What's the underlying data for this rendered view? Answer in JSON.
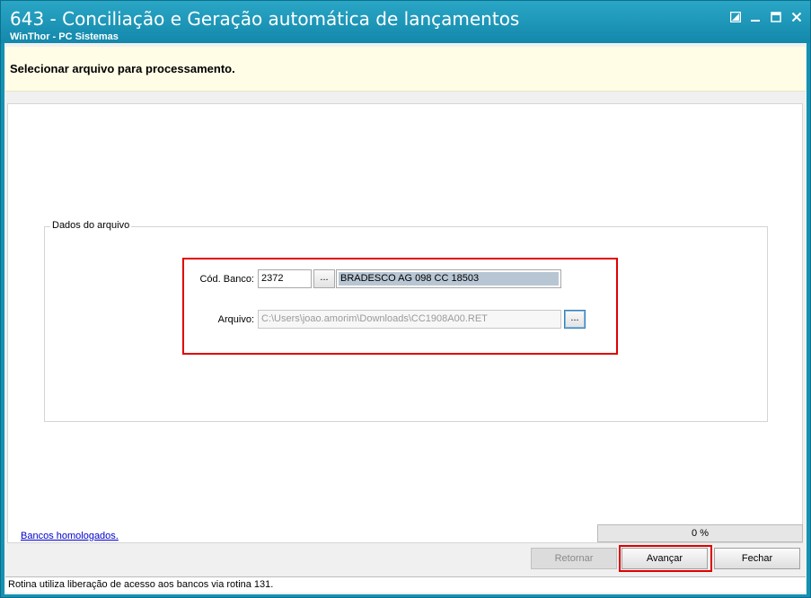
{
  "window": {
    "title": "643 - Conciliação e Geração automática de lançamentos",
    "subtitle": "WinThor - PC Sistemas",
    "controls": {
      "restore_icon": "restore-icon",
      "minimize_icon": "minimize-icon",
      "maximize_icon": "maximize-icon",
      "close_icon": "close-icon"
    }
  },
  "header": {
    "text": "Selecionar arquivo para processamento."
  },
  "form": {
    "group_title": "Dados do arquivo",
    "cod_banco_label": "Cód. Banco:",
    "cod_banco_value": "2372",
    "banco_lookup_button": "...",
    "banco_description": "BRADESCO AG 098 CC 18503",
    "arquivo_label": "Arquivo:",
    "arquivo_value": "C:\\Users\\joao.amorim\\Downloads\\CC1908A00.RET",
    "arquivo_browse_button": "..."
  },
  "footer": {
    "link_text": "Bancos homologados.",
    "progress_text": "0 %",
    "progress_value": 0,
    "buttons": {
      "retornar": "Retornar",
      "avancar": "Avançar",
      "fechar": "Fechar"
    }
  },
  "status": {
    "text": "Rotina utiliza liberação de acesso aos bancos via rotina 131."
  },
  "colors": {
    "title_bar": "#1592b3",
    "header_band": "#fffde6",
    "highlight": "#e00000",
    "link": "#0000cc"
  }
}
